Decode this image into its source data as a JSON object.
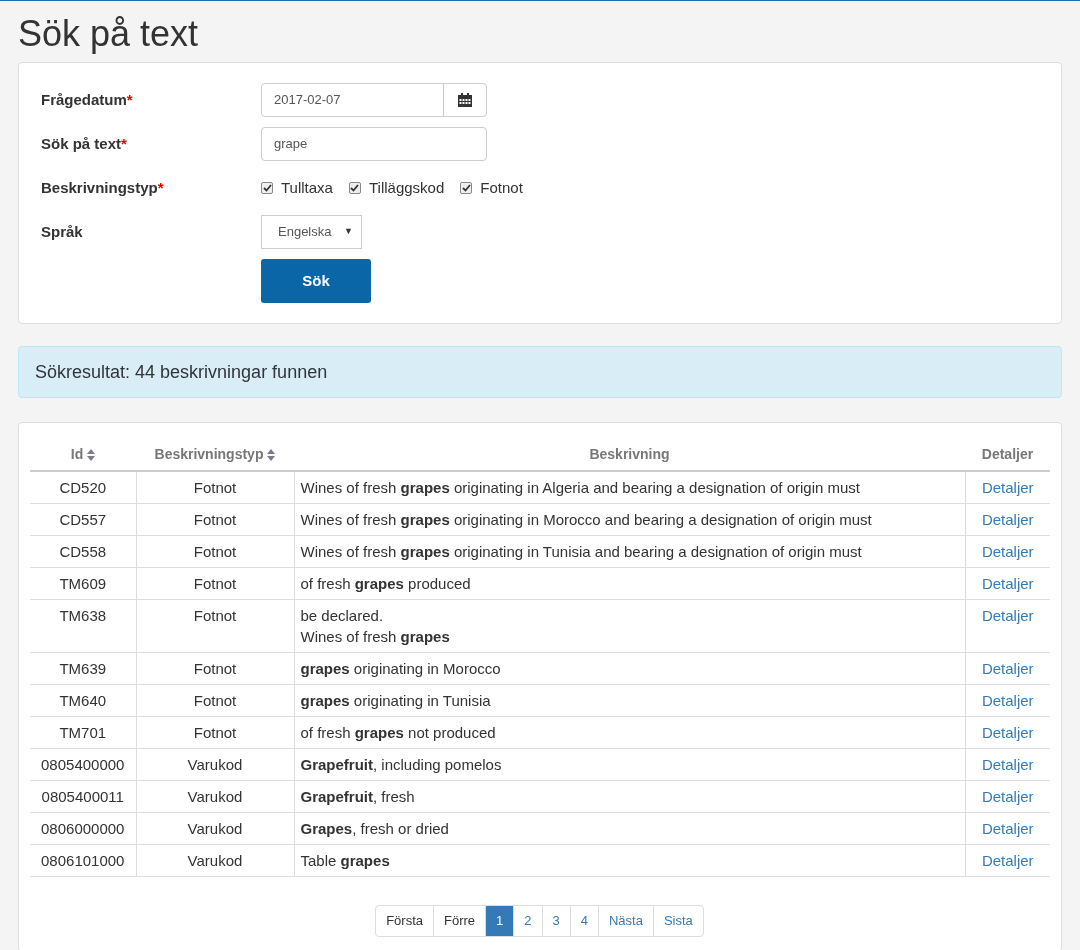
{
  "title": "Sök på text",
  "form": {
    "date": {
      "label": "Frågedatum",
      "required": true,
      "value": "2017-02-07"
    },
    "text": {
      "label": "Sök på text",
      "required": true,
      "value": "grape"
    },
    "types": {
      "label": "Beskrivningstyp",
      "required": true,
      "options": [
        {
          "label": "Tulltaxa",
          "checked": true
        },
        {
          "label": "Tilläggskod",
          "checked": true
        },
        {
          "label": "Fotnot",
          "checked": true
        }
      ]
    },
    "language": {
      "label": "Språk",
      "value": "Engelska",
      "caret": "▼"
    },
    "required_mark": "*",
    "submit": "Sök"
  },
  "result": "Sökresultat: 44 beskrivningar funnen",
  "table": {
    "columns": [
      {
        "label": "Id",
        "sortable": true
      },
      {
        "label": "Beskrivningstyp",
        "sortable": true
      },
      {
        "label": "Beskrivning",
        "sortable": false
      },
      {
        "label": "Detaljer",
        "sortable": false
      }
    ],
    "rows": [
      {
        "id": "CD520",
        "type": "Fotnot",
        "description": "Wines of fresh **grapes** originating in Algeria and bearing a designation of origin must",
        "link": "Detaljer"
      },
      {
        "id": "CD557",
        "type": "Fotnot",
        "description": "Wines of fresh **grapes** originating in Morocco and bearing a designation of origin must",
        "link": "Detaljer"
      },
      {
        "id": "CD558",
        "type": "Fotnot",
        "description": "Wines of fresh **grapes** originating in Tunisia and bearing a designation of origin must",
        "link": "Detaljer"
      },
      {
        "id": "TM609",
        "type": "Fotnot",
        "description": "of fresh **grapes** produced",
        "link": "Detaljer"
      },
      {
        "id": "TM638",
        "type": "Fotnot",
        "description": "be declared.\nWines of fresh **grapes**",
        "link": "Detaljer"
      },
      {
        "id": "TM639",
        "type": "Fotnot",
        "description": "**grapes** originating in Morocco",
        "link": "Detaljer"
      },
      {
        "id": "TM640",
        "type": "Fotnot",
        "description": "**grapes** originating in Tunisia",
        "link": "Detaljer"
      },
      {
        "id": "TM701",
        "type": "Fotnot",
        "description": "of fresh **grapes** not produced",
        "link": "Detaljer"
      },
      {
        "id": "0805400000",
        "type": "Varukod",
        "description": "**Grapefruit**, including pomelos",
        "link": "Detaljer"
      },
      {
        "id": "0805400011",
        "type": "Varukod",
        "description": "**Grapefruit**, fresh",
        "link": "Detaljer"
      },
      {
        "id": "0806000000",
        "type": "Varukod",
        "description": "**Grapes**, fresh or dried",
        "link": "Detaljer"
      },
      {
        "id": "0806101000",
        "type": "Varukod",
        "description": "Table **grapes**",
        "link": "Detaljer"
      }
    ]
  },
  "pagination": [
    {
      "label": "Första",
      "selected": false,
      "disabled": true
    },
    {
      "label": "Förre",
      "selected": false,
      "disabled": true
    },
    {
      "label": "1",
      "selected": true,
      "disabled": false
    },
    {
      "label": "2",
      "selected": false,
      "disabled": false
    },
    {
      "label": "3",
      "selected": false,
      "disabled": false
    },
    {
      "label": "4",
      "selected": false,
      "disabled": false
    },
    {
      "label": "Nästa",
      "selected": false,
      "disabled": false
    },
    {
      "label": "Sista",
      "selected": false,
      "disabled": false
    }
  ]
}
